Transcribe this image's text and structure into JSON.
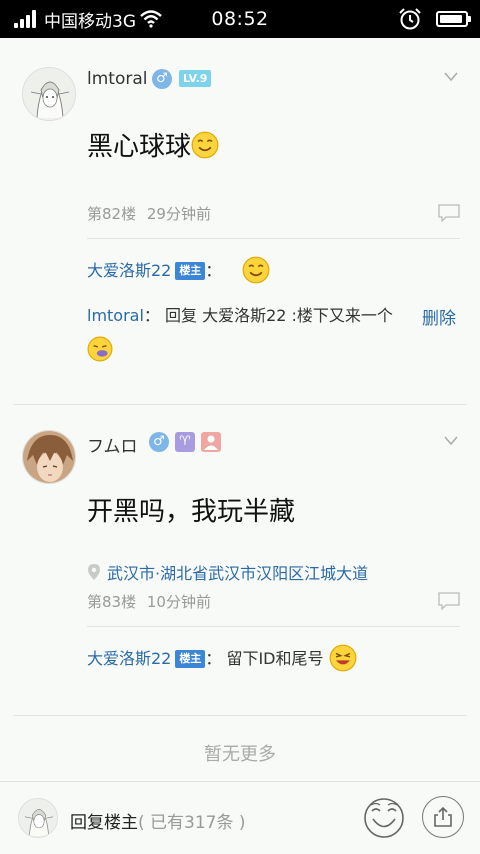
{
  "status_bar": {
    "carrier": "中国移动3G",
    "time": "08:52",
    "battery_level": 0.9
  },
  "icons": {
    "signal": "signal-strength-icon",
    "wifi": "wifi-icon",
    "alarm": "alarm-icon",
    "battery": "battery-icon",
    "male": "♂",
    "aries": "♈",
    "person": "person-icon",
    "chevron": "chevron-down-icon",
    "comment": "comment-icon",
    "location": "location-pin-icon",
    "smiley": "smiley-icon",
    "share": "share-icon"
  },
  "posts": [
    {
      "username": "lmtoral",
      "level": "LV.9",
      "content": "黑心球球",
      "floor": "第82楼",
      "time": "29分钟前",
      "replies": [
        {
          "name": "大爱洛斯22",
          "tag": "楼主",
          "text": "："
        },
        {
          "name": "lmtoral",
          "text": "：  回复 大爱洛斯22 :楼下又来一个",
          "action": "删除"
        }
      ]
    },
    {
      "username": "フムロ",
      "content": "开黑吗，我玩半藏",
      "location": "武汉市·湖北省武汉市汉阳区江城大道",
      "floor": "第83楼",
      "time": "10分钟前",
      "replies": [
        {
          "name": "大爱洛斯22",
          "tag": "楼主",
          "text": "：  留下ID和尾号"
        }
      ]
    }
  ],
  "footer": {
    "no_more": "暂无更多"
  },
  "bottom_bar": {
    "reply_label": "回复楼主",
    "reply_count": "( 已有317条 )"
  },
  "colors": {
    "link": "#2b6aa8",
    "host_tag": "#3b86d6",
    "level_badge": "#7dd3ec",
    "male_badge": "#7fb6e8",
    "aries_badge": "#a99be0",
    "person_badge": "#f0a7a1"
  }
}
